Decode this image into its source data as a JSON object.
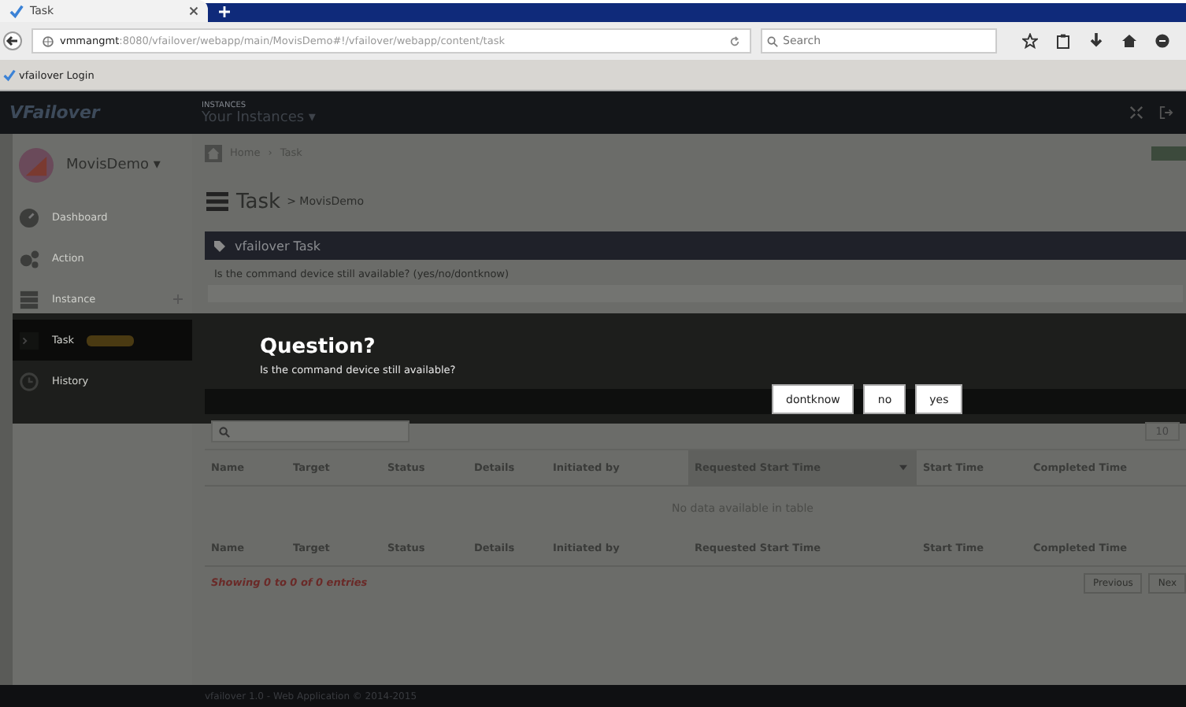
{
  "browser": {
    "tab_title": "Task",
    "url_host": "vmmangmt",
    "url_rest": ":8080/vfailover/webapp/main/MovisDemo#!/vfailover/webapp/content/task",
    "search_placeholder": "Search",
    "bookmark": "vfailover Login"
  },
  "app_header": {
    "logo": "VFailover",
    "instances_label": "INSTANCES",
    "instances_menu": "Your Instances ▾"
  },
  "sidebar": {
    "user": "MovisDemo ▾",
    "items": [
      {
        "kind": "dashboard",
        "label": "Dashboard",
        "selected": false,
        "badge": false
      },
      {
        "kind": "action",
        "label": "Action",
        "selected": false,
        "badge": false
      },
      {
        "kind": "instance",
        "label": "Instance",
        "selected": false,
        "badge": false
      },
      {
        "kind": "task",
        "label": "Task",
        "selected": true,
        "badge": true
      },
      {
        "kind": "history",
        "label": "History",
        "selected": false,
        "badge": false
      }
    ]
  },
  "breadcrumb": [
    "Home",
    "Task"
  ],
  "breadcrumb_separator": "›",
  "page_title": "Task",
  "page_subtitle": "> MovisDemo",
  "task_panel": {
    "title": "vfailover Task",
    "question": "Is the command device still available? (yes/no/dontknow)"
  },
  "dialog": {
    "title": "Question?",
    "message": "Is the command device still available?",
    "buttons": [
      "dontknow",
      "no",
      "yes"
    ]
  },
  "tasks_table": {
    "page_size": "10",
    "columns": [
      {
        "label": "Name",
        "sorted": false
      },
      {
        "label": "Target",
        "sorted": false
      },
      {
        "label": "Status",
        "sorted": false
      },
      {
        "label": "Details",
        "sorted": false
      },
      {
        "label": "Initiated by",
        "sorted": false
      },
      {
        "label": "Requested Start Time",
        "sorted": true
      },
      {
        "label": "Start Time",
        "sorted": false
      },
      {
        "label": "Completed Time",
        "sorted": false
      }
    ],
    "empty_message": "No data available in table",
    "footer_columns": [
      "Name",
      "Target",
      "Status",
      "Details",
      "Initiated by",
      "Requested Start Time",
      "Start Time",
      "Completed Time"
    ],
    "info": "Showing 0 to 0 of 0 entries",
    "pagination": [
      "Previous",
      "Nex"
    ]
  },
  "footer": "vfailover 1.0 - Web Application © 2014-2015"
}
